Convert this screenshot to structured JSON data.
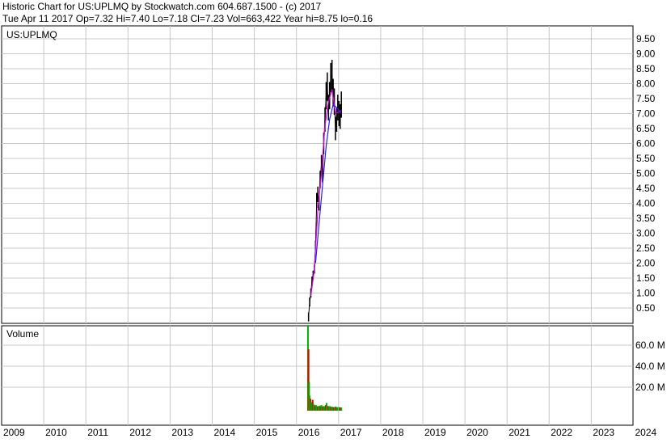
{
  "header": {
    "line1": "Historic Chart for US:UPLMQ by Stockwatch.com 604.687.1500 - (c) 2017",
    "line2": "Tue Apr 11 2017  Op=7.32  Hi=7.40  Lo=7.18  Cl=7.23  Vol=663,422  Year hi=8.75  lo=0.16"
  },
  "colors": {
    "background": "#ffffff",
    "grid": "#c8c8c8",
    "price_candle": "#000000",
    "ma_short": "#e000e0",
    "ma_long": "#2020ff",
    "volume_up": "#00b000",
    "volume_down": "#e00000"
  },
  "chart_data": [
    {
      "type": "candlestick",
      "title": "US:UPLMQ",
      "x_axis": {
        "labels": [
          "2009",
          "2010",
          "2011",
          "2012",
          "2013",
          "2014",
          "2015",
          "2016",
          "2017",
          "2018",
          "2019",
          "2020",
          "2021",
          "2022",
          "2023",
          "2024"
        ],
        "range": [
          "2009-01-01",
          "2024-12-31"
        ]
      },
      "y_axis": {
        "ticks": [
          "0.50",
          "1.00",
          "1.50",
          "2.00",
          "2.50",
          "3.00",
          "3.50",
          "4.00",
          "4.50",
          "5.00",
          "5.50",
          "6.00",
          "6.50",
          "7.00",
          "7.50",
          "8.00",
          "8.50",
          "9.00",
          "9.50"
        ],
        "range": [
          0,
          9.75
        ]
      },
      "grid": true,
      "year_hi": 8.75,
      "year_lo": 0.16,
      "price_path": [
        [
          "2016-04-15",
          0.2
        ],
        [
          "2016-04-25",
          0.7
        ],
        [
          "2016-05-05",
          1.0
        ],
        [
          "2016-05-15",
          1.4
        ],
        [
          "2016-05-25",
          1.6
        ],
        [
          "2016-06-05",
          1.8
        ],
        [
          "2016-06-15",
          2.6
        ],
        [
          "2016-06-25",
          4.1
        ],
        [
          "2016-07-05",
          4.3
        ],
        [
          "2016-07-15",
          4.0
        ],
        [
          "2016-07-25",
          4.8
        ],
        [
          "2016-08-05",
          5.3
        ],
        [
          "2016-08-15",
          5.0
        ],
        [
          "2016-08-25",
          6.0
        ],
        [
          "2016-09-05",
          6.8
        ],
        [
          "2016-09-15",
          7.6
        ],
        [
          "2016-09-25",
          7.9
        ],
        [
          "2016-10-05",
          7.2
        ],
        [
          "2016-10-15",
          7.6
        ],
        [
          "2016-10-25",
          8.2
        ],
        [
          "2016-11-05",
          8.3
        ],
        [
          "2016-11-15",
          7.7
        ],
        [
          "2016-11-25",
          7.4
        ],
        [
          "2016-12-05",
          6.5
        ],
        [
          "2016-12-15",
          6.8
        ],
        [
          "2016-12-25",
          7.2
        ],
        [
          "2017-01-05",
          7.0
        ],
        [
          "2017-01-15",
          6.9
        ],
        [
          "2017-01-25",
          7.3
        ]
      ],
      "moving_averages": [
        {
          "values": [
            [
              "2016-05-05",
              0.9
            ],
            [
              "2016-06-05",
              1.8
            ],
            [
              "2016-07-05",
              3.8
            ],
            [
              "2016-08-05",
              5.0
            ],
            [
              "2016-09-05",
              6.6
            ],
            [
              "2016-10-05",
              7.4
            ],
            [
              "2016-11-05",
              7.8
            ],
            [
              "2016-12-05",
              7.0
            ],
            [
              "2017-01-25",
              7.1
            ]
          ]
        },
        {
          "values": [
            [
              "2016-06-15",
              2.0
            ],
            [
              "2016-07-15",
              3.3
            ],
            [
              "2016-08-15",
              4.6
            ],
            [
              "2016-09-15",
              5.9
            ],
            [
              "2016-10-15",
              6.8
            ],
            [
              "2016-11-15",
              7.3
            ],
            [
              "2016-12-15",
              7.2
            ],
            [
              "2017-01-25",
              7.0
            ]
          ]
        }
      ]
    },
    {
      "type": "bar",
      "title": "Volume",
      "y_axis": {
        "ticks": [
          "20.0 M",
          "40.0 M",
          "60.0 M"
        ],
        "range": [
          0,
          80
        ]
      },
      "volume_bars": [
        [
          "2016-04-10",
          79
        ],
        [
          "2016-04-15",
          56
        ],
        [
          "2016-04-20",
          25
        ],
        [
          "2016-04-25",
          12
        ],
        [
          "2016-05-01",
          9
        ],
        [
          "2016-05-07",
          6
        ],
        [
          "2016-05-14",
          5
        ],
        [
          "2016-05-21",
          8
        ],
        [
          "2016-05-28",
          4
        ],
        [
          "2016-06-05",
          3
        ],
        [
          "2016-06-12",
          2
        ],
        [
          "2016-06-19",
          3
        ],
        [
          "2016-06-26",
          2
        ],
        [
          "2016-07-05",
          1.5
        ],
        [
          "2016-07-12",
          2
        ],
        [
          "2016-07-20",
          2.5
        ],
        [
          "2016-07-28",
          1.5
        ],
        [
          "2016-08-05",
          3
        ],
        [
          "2016-08-12",
          2
        ],
        [
          "2016-08-20",
          1.5
        ],
        [
          "2016-08-28",
          2
        ],
        [
          "2016-09-05",
          2
        ],
        [
          "2016-09-12",
          3
        ],
        [
          "2016-09-19",
          5
        ],
        [
          "2016-09-26",
          2
        ],
        [
          "2016-10-05",
          2
        ],
        [
          "2016-10-12",
          1.5
        ],
        [
          "2016-10-19",
          2
        ],
        [
          "2016-10-28",
          1
        ],
        [
          "2016-11-05",
          1.5
        ],
        [
          "2016-11-12",
          1
        ],
        [
          "2016-11-20",
          1
        ],
        [
          "2016-11-28",
          1
        ],
        [
          "2016-12-05",
          1.5
        ],
        [
          "2016-12-12",
          1
        ],
        [
          "2016-12-20",
          1
        ],
        [
          "2017-01-05",
          1
        ],
        [
          "2017-01-15",
          0.8
        ],
        [
          "2017-01-25",
          0.7
        ]
      ]
    }
  ]
}
